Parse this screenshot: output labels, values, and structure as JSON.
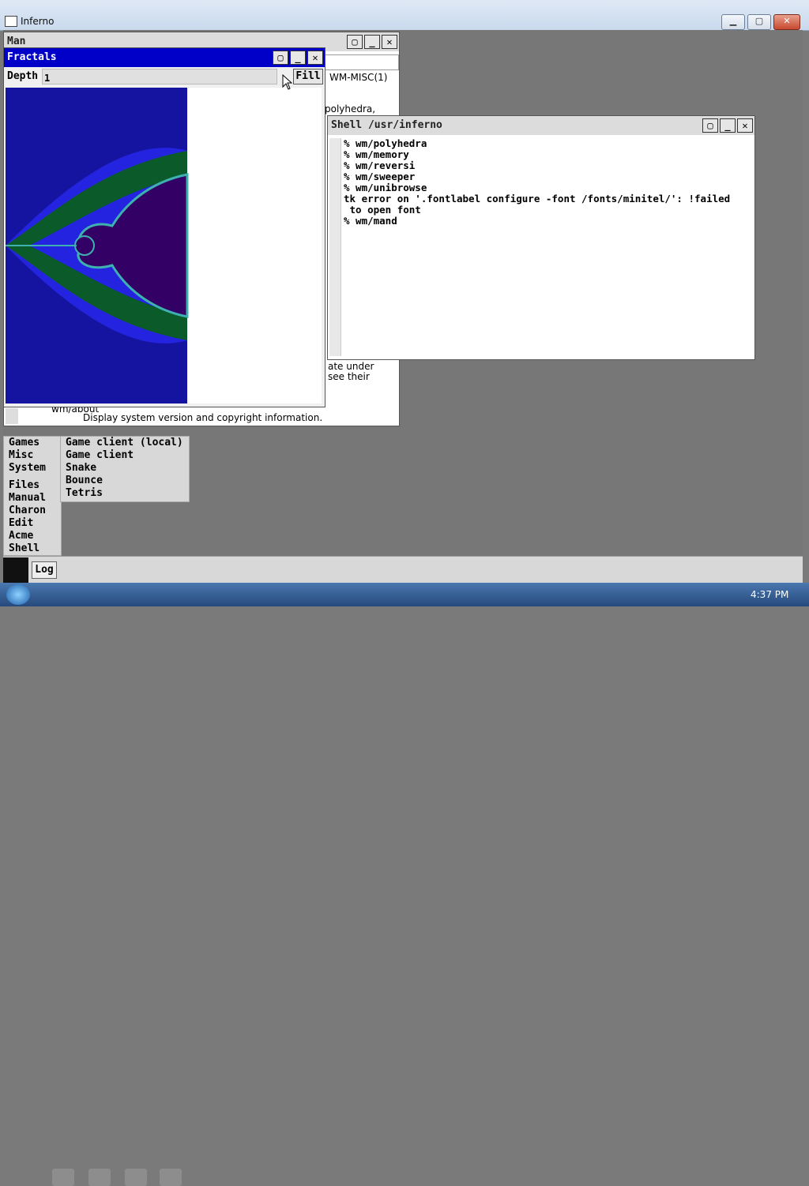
{
  "host": {
    "title": "Inferno",
    "min": "▁",
    "max": "▢",
    "close": "✕"
  },
  "man": {
    "title": "Man",
    "header": "WM-MISC(1)",
    "frag1": "polyhedra,",
    "frag2": "ate under",
    "frag3": "see their",
    "frag4": "wm/about",
    "footer": "Display system version and copyright information."
  },
  "fractals": {
    "title": "Fractals",
    "depth_label": "Depth",
    "depth_value": "1",
    "fill_button": "Fill"
  },
  "shell": {
    "title": "Shell /usr/inferno",
    "lines": [
      "% wm/polyhedra",
      "% wm/memory",
      "% wm/reversi",
      "% wm/sweeper",
      "% wm/unibrowse",
      "tk error on '.fontlabel configure -font /fonts/minitel/': !failed",
      " to open font",
      "% wm/mand"
    ]
  },
  "start_menu": {
    "items": [
      "Games",
      "Misc",
      "System",
      "Files",
      "Manual",
      "Charon",
      "Edit",
      "Acme",
      "Shell"
    ]
  },
  "games_submenu": {
    "items": [
      "Game client (local)",
      "Game client",
      "Snake",
      "Bounce",
      "Tetris"
    ]
  },
  "inferno_taskbar": {
    "log_button": "Log"
  },
  "win_taskbar": {
    "clock": "4:37 PM"
  },
  "colors": {
    "active_title": "#0000c8",
    "desktop": "#777777",
    "fractal_inner": "#330066"
  }
}
